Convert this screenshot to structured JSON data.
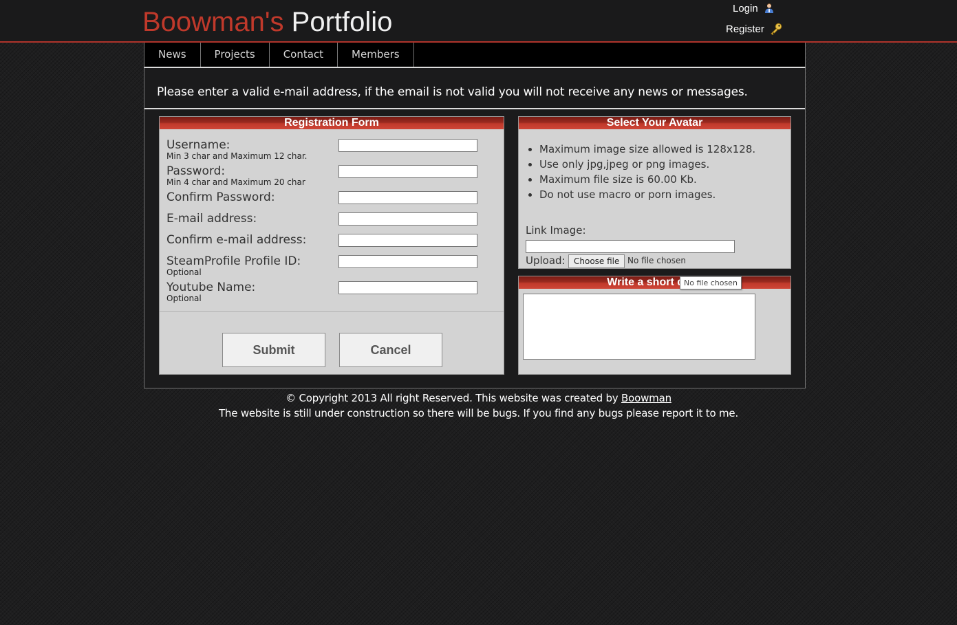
{
  "header": {
    "title_part1": "Boowman's",
    "title_part2": "Portfolio",
    "login": "Login",
    "register": "Register"
  },
  "nav": {
    "items": [
      {
        "label": "News"
      },
      {
        "label": "Projects"
      },
      {
        "label": "Contact"
      },
      {
        "label": "Members"
      }
    ]
  },
  "notice": "Please enter a valid e-mail address, if the email is not valid you will not receive any news or messages.",
  "registration": {
    "title": "Registration Form",
    "fields": [
      {
        "label": "Username:",
        "hint": "Min 3 char and Maximum 12 char.",
        "value": ""
      },
      {
        "label": "Password:",
        "hint": "Min 4 char and Maximum 20 char",
        "value": ""
      },
      {
        "label": "Confirm Password:",
        "hint": "",
        "value": ""
      },
      {
        "label": "E-mail address:",
        "hint": "",
        "value": ""
      },
      {
        "label": "Confirm e-mail address:",
        "hint": "",
        "value": ""
      },
      {
        "label": "SteamProfile Profile ID:",
        "hint": "Optional",
        "value": ""
      },
      {
        "label": "Youtube Name:",
        "hint": "Optional",
        "value": ""
      }
    ],
    "submit_label": "Submit",
    "cancel_label": "Cancel"
  },
  "avatar": {
    "title": "Select Your Avatar",
    "rules": [
      "Maximum image size allowed is 128x128.",
      "Use only jpg,jpeg or png images.",
      "Maximum file size is 60.00 Kb.",
      "Do not use macro or porn images."
    ],
    "link_label": "Link Image:",
    "link_value": "",
    "upload_label": "Upload:",
    "choose_file_label": "Choose file",
    "file_status": "No file chosen",
    "tooltip": "No file chosen"
  },
  "description": {
    "title": "Write a short desc",
    "value": ""
  },
  "footer": {
    "copyright": "© Copyright 2013 All right Reserved. This website was created by",
    "author": "Boowman",
    "construction": "The website is still under construction so there will be bugs. If you find any bugs please report it to me."
  },
  "colors": {
    "accent": "#c0392b",
    "panel_bg": "#d3d3d3",
    "page_bg": "#1e1e1f"
  },
  "icons": {
    "login": "user-icon",
    "register": "key-icon"
  }
}
